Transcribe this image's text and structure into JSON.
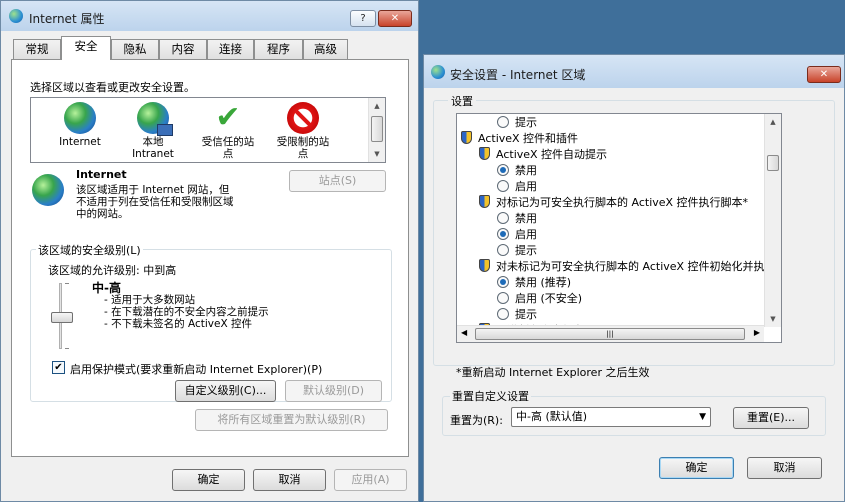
{
  "left": {
    "title": "Internet 属性",
    "help": "?",
    "close": "✕",
    "tabs": [
      "常规",
      "安全",
      "隐私",
      "内容",
      "连接",
      "程序",
      "高级"
    ],
    "zone_prompt": "选择区域以查看或更改安全设置。",
    "zones": [
      {
        "label": "Internet",
        "icon": "globe-icon"
      },
      {
        "label": "本地\nIntranet",
        "icon": "intranet-icon"
      },
      {
        "label": "受信任的站\n点",
        "icon": "check-icon"
      },
      {
        "label": "受限制的站\n点",
        "icon": "restricted-icon"
      }
    ],
    "zone_name": "Internet",
    "zone_desc": "该区域适用于 Internet 网站，但\n不适用于列在受信任和受限制区域\n中的网站。",
    "sites_button": "站点(S)",
    "security_group": "该区域的安全级别(L)",
    "allowed_levels": "该区域的允许级别: 中到高",
    "level_title": "中-高",
    "level_bullets": [
      "- 适用于大多数网站",
      "- 在下载潜在的不安全内容之前提示",
      "- 不下载未签名的 ActiveX 控件"
    ],
    "protected_mode": "启用保护模式(要求重新启动 Internet Explorer)(P)",
    "protected_mode_checked": true,
    "custom_level_button": "自定义级别(C)...",
    "default_level_button": "默认级别(D)",
    "reset_all_button": "将所有区域重置为默认级别(R)",
    "ok": "确定",
    "cancel": "取消",
    "apply": "应用(A)",
    "slider_level": 0.67
  },
  "right": {
    "title": "安全设置 - Internet 区域",
    "close": "✕",
    "settings_group": "设置",
    "settings": [
      {
        "kind": "radio",
        "indent": 2,
        "label": "提示",
        "on": false
      },
      {
        "kind": "head",
        "indent": 0,
        "label": "ActiveX 控件和插件"
      },
      {
        "kind": "head",
        "indent": 1,
        "label": "ActiveX 控件自动提示"
      },
      {
        "kind": "radio",
        "indent": 2,
        "label": "禁用",
        "on": true
      },
      {
        "kind": "radio",
        "indent": 2,
        "label": "启用",
        "on": false
      },
      {
        "kind": "head",
        "indent": 1,
        "label": "对标记为可安全执行脚本的 ActiveX 控件执行脚本*"
      },
      {
        "kind": "radio",
        "indent": 2,
        "label": "禁用",
        "on": false
      },
      {
        "kind": "radio",
        "indent": 2,
        "label": "启用",
        "on": true
      },
      {
        "kind": "radio",
        "indent": 2,
        "label": "提示",
        "on": false
      },
      {
        "kind": "head",
        "indent": 1,
        "label": "对未标记为可安全执行脚本的 ActiveX 控件初始化并执"
      },
      {
        "kind": "radio",
        "indent": 2,
        "label": "禁用 (推荐)",
        "on": true
      },
      {
        "kind": "radio",
        "indent": 2,
        "label": "启用 (不安全)",
        "on": false
      },
      {
        "kind": "radio",
        "indent": 2,
        "label": "提示",
        "on": false
      },
      {
        "kind": "head",
        "indent": 1,
        "label": "二进制和脚本行为"
      }
    ],
    "restart_note": "*重新启动 Internet Explorer 之后生效",
    "reset_group": "重置自定义设置",
    "reset_to_label": "重置为(R):",
    "reset_to_value": "中-高 (默认值)",
    "reset_button": "重置(E)...",
    "ok": "确定",
    "cancel": "取消",
    "scroll_position": 0.15
  }
}
